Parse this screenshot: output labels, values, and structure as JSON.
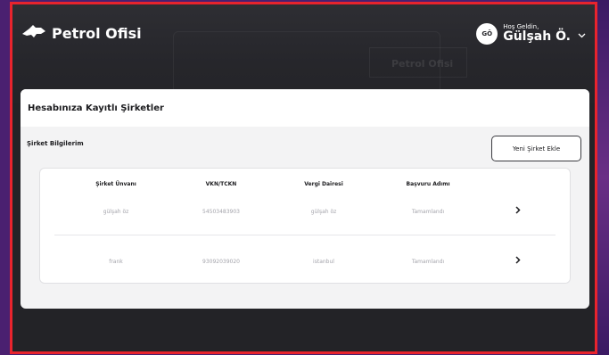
{
  "header": {
    "logo_text": "Petrol Ofisi",
    "watermark_text": "Petrol Ofisi",
    "user": {
      "initials": "GÖ",
      "greeting": "Hoş Geldin,",
      "name": "Gülşah Ö."
    }
  },
  "panel": {
    "title": "Hesabınıza Kayıtlı Şirketler",
    "section_title": "Şirket Bilgilerim",
    "add_button_label": "Yeni Şirket Ekle",
    "table": {
      "columns": [
        "Şirket Ünvanı",
        "VKN/TCKN",
        "Vergi Dairesi",
        "Başvuru Adımı"
      ],
      "rows": [
        {
          "company": "gülşah öz",
          "vkn": "54503483903",
          "tax_office": "gülşah öz",
          "step": "Tamamlandı",
          "action_icon": "chevron-right-icon"
        },
        {
          "company": "frank",
          "vkn": "93092039020",
          "tax_office": "istanbul",
          "step": "Tamamlandı",
          "action_icon": "chevron-right-icon"
        }
      ]
    }
  },
  "colors": {
    "frame_border": "#e8242d",
    "dark_background": "#232327",
    "panel_background": "#f3f3f4",
    "muted_text": "#a4a4ab"
  }
}
